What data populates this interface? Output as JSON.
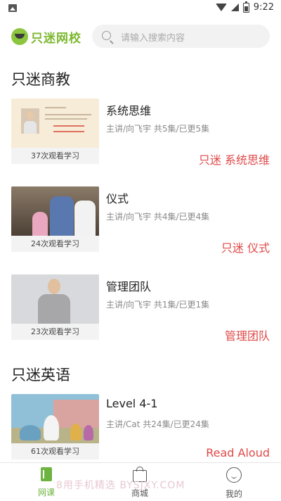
{
  "status_bar": {
    "time": "9:22"
  },
  "header": {
    "logo_text": "只迷网校",
    "search_placeholder": "请输入搜索内容"
  },
  "sections": [
    {
      "title": "只迷商教",
      "courses": [
        {
          "title": "系统思维",
          "meta": "主讲/向飞宇 共5集/已更5集",
          "views": "37次观看学习",
          "tag": "只迷 系统思维"
        },
        {
          "title": "仪式",
          "meta": "主讲/向飞宇 共4集/已更4集",
          "views": "24次观看学习",
          "tag": "只迷 仪式"
        },
        {
          "title": "管理团队",
          "meta": "主讲/向飞宇 共1集/已更1集",
          "views": "23次观看学习",
          "tag": "管理团队"
        }
      ]
    },
    {
      "title": "只迷英语",
      "courses": [
        {
          "title": "Level 4-1",
          "meta": "主讲/Cat 共24集/已更24集",
          "views": "61次观看学习",
          "tag": "Read Aloud"
        }
      ]
    }
  ],
  "tabbar": {
    "items": [
      {
        "label": "网课",
        "icon": "book-icon",
        "active": true
      },
      {
        "label": "商城",
        "icon": "shopping-bag-icon",
        "active": false
      },
      {
        "label": "我的",
        "icon": "profile-face-icon",
        "active": false
      }
    ]
  },
  "watermark": "8用手机精选 BYSJXY.COM",
  "colors": {
    "accent": "#6db33f",
    "tag": "#e04848"
  }
}
